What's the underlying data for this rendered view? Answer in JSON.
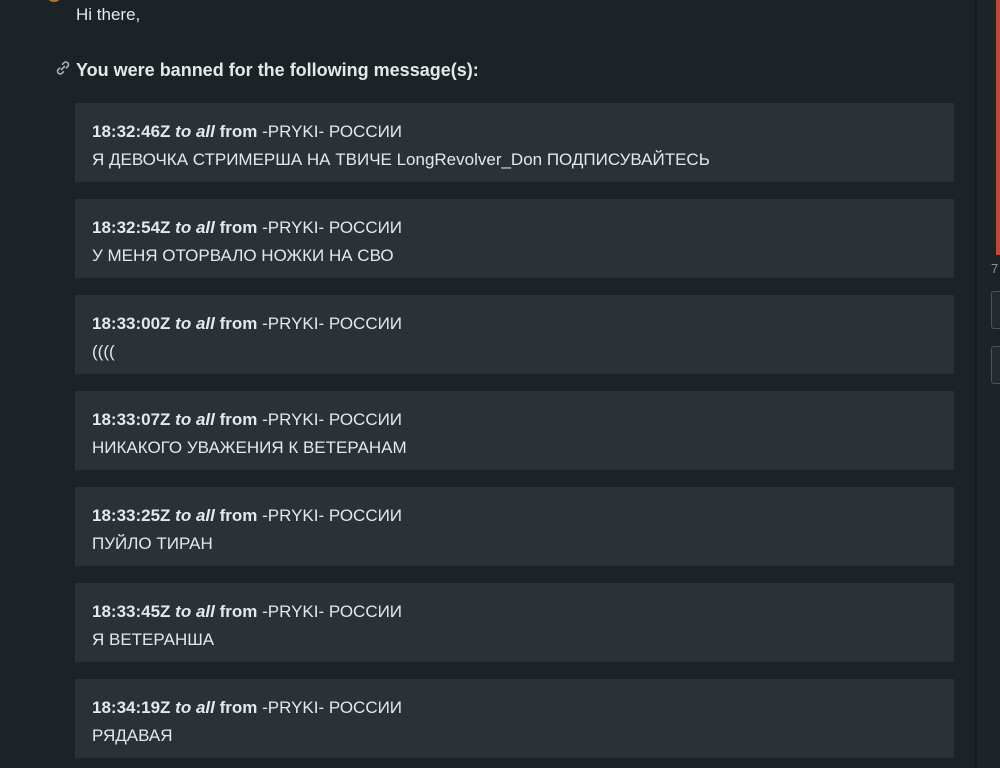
{
  "greeting": "Hi there,",
  "heading": "You were banned for the following message(s):",
  "icons": {
    "link": "link-icon"
  },
  "colors": {
    "background": "#1c2326",
    "card": "#2a3237",
    "text": "#e4e8ea",
    "accent_red": "#c0453d"
  },
  "messages": [
    {
      "time": "18:32:46Z",
      "to": "to all",
      "from_label": "from",
      "sender": "-PRYKI- РОССИИ",
      "text": "Я ДЕВОЧКА СТРИМЕРША НА ТВИЧЕ LongRevolver_Don ПОДПИСУВАЙТЕСЬ"
    },
    {
      "time": "18:32:54Z",
      "to": "to all",
      "from_label": "from",
      "sender": "-PRYKI- РОССИИ",
      "text": "У МЕНЯ ОТОРВАЛО НОЖКИ НА СВО"
    },
    {
      "time": "18:33:00Z",
      "to": "to all",
      "from_label": "from",
      "sender": "-PRYKI- РОССИИ",
      "text": "(((("
    },
    {
      "time": "18:33:07Z",
      "to": "to all",
      "from_label": "from",
      "sender": "-PRYKI- РОССИИ",
      "text": "НИКАКОГО УВАЖЕНИЯ К ВЕТЕРАНАМ"
    },
    {
      "time": "18:33:25Z",
      "to": "to all",
      "from_label": "from",
      "sender": "-PRYKI- РОССИИ",
      "text": "ПУЙЛО ТИРАН"
    },
    {
      "time": "18:33:45Z",
      "to": "to all",
      "from_label": "from",
      "sender": "-PRYKI- РОССИИ",
      "text": "Я ВЕТЕРАНША"
    },
    {
      "time": "18:34:19Z",
      "to": "to all",
      "from_label": "from",
      "sender": "-PRYKI- РОССИИ",
      "text": "РЯДАВАЯ"
    }
  ],
  "right_panel": {
    "digit": "7"
  }
}
